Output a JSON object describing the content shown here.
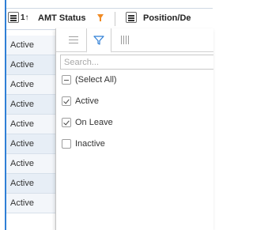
{
  "grid": {
    "columns": [
      {
        "title": "AMT Status",
        "filtered": true
      },
      {
        "title": "Position/De",
        "filtered": false
      }
    ],
    "sort_indicator": "1↑",
    "rows": [
      "Active",
      "Active",
      "Active",
      "Active",
      "Active",
      "Active",
      "Active",
      "Active",
      "Active"
    ]
  },
  "filter_panel": {
    "tabs": [
      {
        "name": "general",
        "icon": "menu-lines-icon",
        "active": false
      },
      {
        "name": "filter",
        "icon": "funnel-icon",
        "active": true
      },
      {
        "name": "columns",
        "icon": "columns-icon",
        "active": false
      }
    ],
    "search": {
      "placeholder": "Search...",
      "value": ""
    },
    "options": [
      {
        "label": "(Select All)",
        "state": "indeterminate"
      },
      {
        "label": "Active",
        "state": "checked"
      },
      {
        "label": "On Leave",
        "state": "checked"
      },
      {
        "label": "Inactive",
        "state": "unchecked"
      }
    ]
  },
  "colors": {
    "accent": "#2f7fd6",
    "filter_icon": "#f08a24",
    "row_bg": "#f3f6fa"
  }
}
